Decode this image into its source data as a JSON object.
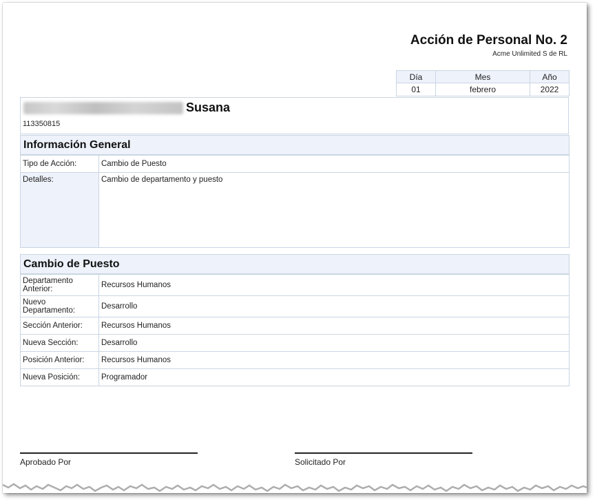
{
  "document": {
    "title": "Acción de Personal No. 2",
    "company": "Acme Unlimited S de RL"
  },
  "date": {
    "headers": [
      "Día",
      "Mes",
      "Año"
    ],
    "day": "01",
    "month": "febrero",
    "year": "2022"
  },
  "employee": {
    "first_name": "Susana",
    "id_number": "113350815"
  },
  "general": {
    "heading": "Información General",
    "rows": [
      {
        "label": "Tipo de Acción:",
        "value": "Cambio de Puesto"
      },
      {
        "label": "Detalles:",
        "value": "Cambio de departamento y puesto"
      }
    ]
  },
  "change": {
    "heading": "Cambio de Puesto",
    "rows": [
      {
        "label": "Departamento Anterior:",
        "value": "Recursos Humanos"
      },
      {
        "label": "Nuevo Departamento:",
        "value": "Desarrollo"
      },
      {
        "label": "Sección Anterior:",
        "value": "Recursos Humanos"
      },
      {
        "label": "Nueva Sección:",
        "value": "Desarrollo"
      },
      {
        "label": "Posición Anterior:",
        "value": "Recursos Humanos"
      },
      {
        "label": "Nueva Posición:",
        "value": "Programador"
      }
    ]
  },
  "signatures": {
    "approved_by": "Aprobado Por",
    "requested_by": "Solicitado Por"
  }
}
